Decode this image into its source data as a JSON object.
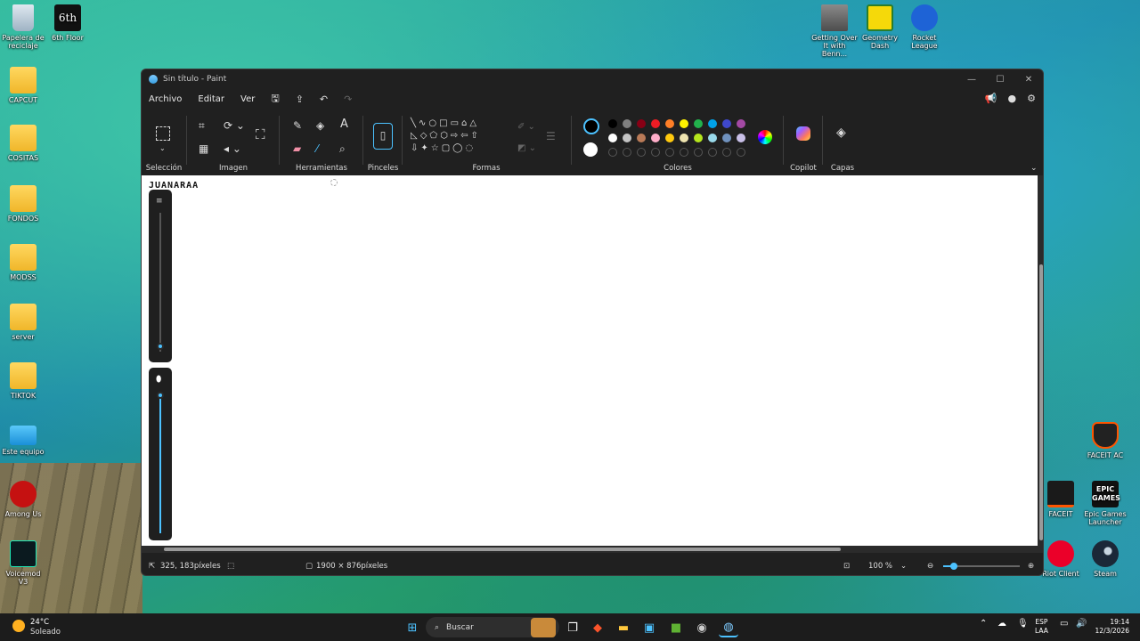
{
  "desktop": {
    "left_icons": [
      {
        "label": "Papelera de reciclaje",
        "kind": "recycle"
      },
      {
        "label": "6th Floor",
        "kind": "app"
      },
      {
        "label": "CAPCUT",
        "kind": "folder"
      },
      {
        "label": "COSITAS",
        "kind": "folder"
      },
      {
        "label": "FONDOS",
        "kind": "folder"
      },
      {
        "label": "MODSS",
        "kind": "folder"
      },
      {
        "label": "server",
        "kind": "folder"
      },
      {
        "label": "TIKTOK",
        "kind": "folder"
      },
      {
        "label": "Este equipo",
        "kind": "pc"
      },
      {
        "label": "Among Us",
        "kind": "app"
      },
      {
        "label": "Voicemod V3",
        "kind": "app"
      }
    ],
    "right_icons": [
      {
        "label": "Getting Over It with Benn..."
      },
      {
        "label": "Geometry Dash"
      },
      {
        "label": "Rocket League"
      },
      {
        "label": "FACEIT AC"
      },
      {
        "label": "FACEIT"
      },
      {
        "label": "Epic Games Launcher"
      },
      {
        "label": "Riot Client"
      },
      {
        "label": "Steam"
      }
    ],
    "sixth_floor_logo": "6th",
    "epic_logo": "EPIC\nGAMES"
  },
  "paint": {
    "title": "Sin título - Paint",
    "menu": {
      "file": "Archivo",
      "edit": "Editar",
      "view": "Ver"
    },
    "groups": {
      "selection": "Selección",
      "image": "Imagen",
      "tools": "Herramientas",
      "brushes": "Pinceles",
      "shapes": "Formas",
      "colors": "Colores",
      "copilot": "Copilot",
      "layers": "Capas"
    },
    "palette_row1": [
      "#000000",
      "#7f7f7f",
      "#880015",
      "#ed1c24",
      "#ff7f27",
      "#fff200",
      "#22b14c",
      "#00a2e8",
      "#3f48cc",
      "#a349a4"
    ],
    "palette_row2": [
      "#ffffff",
      "#c3c3c3",
      "#b97a57",
      "#ffaec9",
      "#ffc90e",
      "#efe4b0",
      "#b5e61d",
      "#99d9ea",
      "#7092be",
      "#c8bfe7"
    ],
    "canvas_scribble": "JUANARAA",
    "status": {
      "cursor": "325, 183píxeles",
      "canvas_size": "1900 × 876píxeles",
      "zoom": "100 %"
    }
  },
  "taskbar": {
    "weather_temp": "24°C",
    "weather_desc": "Soleado",
    "search_placeholder": "Buscar",
    "lang1": "ESP",
    "lang2": "LAA",
    "time": "19:14",
    "date": "12/3/2026"
  }
}
